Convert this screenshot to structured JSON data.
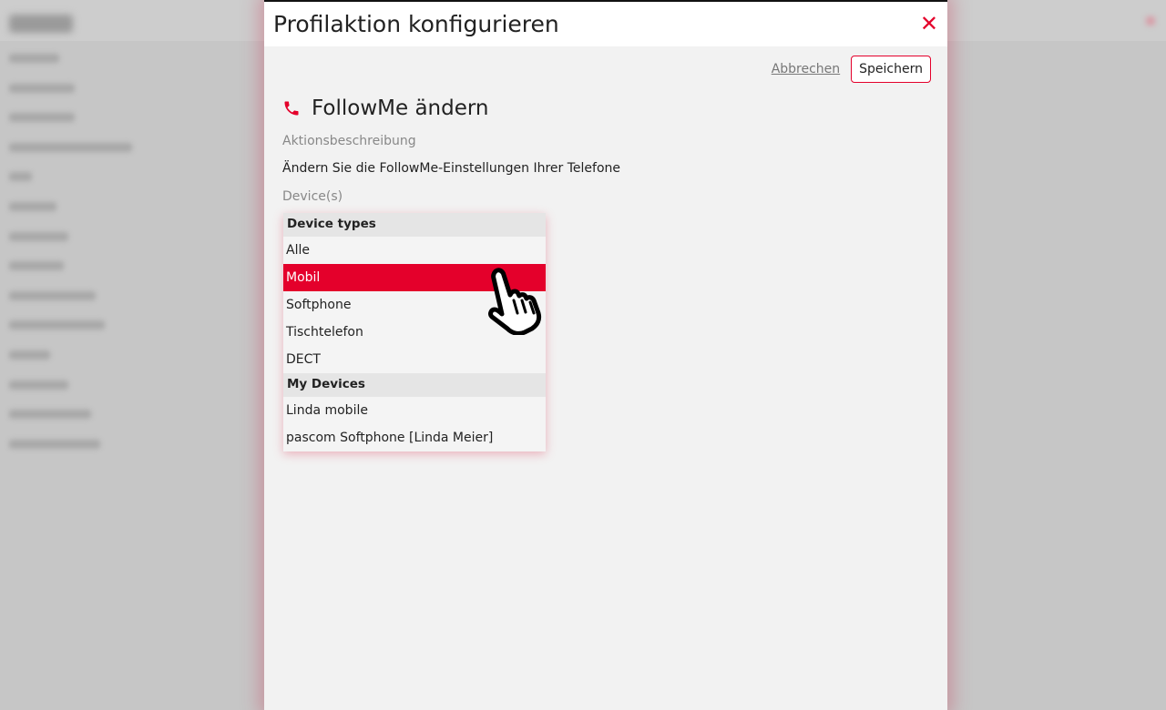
{
  "modal": {
    "title": "Profilaktion konfigurieren",
    "cancel_label": "Abbrechen",
    "save_label": "Speichern",
    "section_title": "FollowMe ändern",
    "description_label": "Aktionsbeschreibung",
    "description_text": "Ändern Sie die FollowMe-Einstellungen Ihrer Telefone",
    "devices_label": "Device(s)"
  },
  "dropdown": {
    "groups": [
      {
        "label": "Device types",
        "options": [
          "Alle",
          "Mobil",
          "Softphone",
          "Tischtelefon",
          "DECT"
        ]
      },
      {
        "label": "My Devices",
        "options": [
          "Linda mobile",
          "pascom Softphone [Linda Meier]"
        ]
      }
    ],
    "highlighted": "Mobil"
  },
  "colors": {
    "accent": "#e4002b",
    "modal_bg": "#f2f2f2",
    "backdrop": "#c6c6c6"
  },
  "icons": {
    "close": "close-icon",
    "section": "phone-icon",
    "cursor": "hand-pointer-icon"
  }
}
